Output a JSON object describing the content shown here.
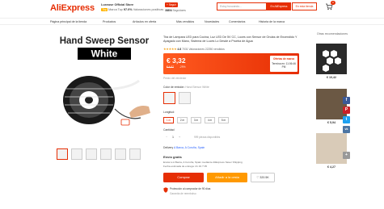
{
  "header": {
    "logo": "AliExpress",
    "store_name": "Luxeuse Official Store",
    "store_tag": "Top",
    "store_badge": "Marca Top",
    "rating_pct": "97.0%",
    "rating_text": "Valoraciones positivas",
    "follow_label": "+ Seguir",
    "followers_count": "38854",
    "followers_label": "Seguidores",
    "search_placeholder": "Estoy buscando...",
    "search_btn": "En AliExpress",
    "search_store_btn": "En esta tienda",
    "cart_count": "0"
  },
  "store_nav": [
    "Página principal de la tienda",
    "Productos",
    "Artículos en oferta",
    "Más vendidos",
    "Novedades",
    "Comentarios",
    "Historia de la marca"
  ],
  "product": {
    "title": "Tira de Lámpara LED para Cocina, Luz LED De 5V CC, Luces con Sensor de Ondas de Encendido Y Apagado con Mano, Sistema de Luces Lo Desde a Prueba de Agua",
    "stars": "★★★★★",
    "rating_value": "4.8",
    "reviews": "7031 Valoraciones",
    "sold": "22250 vendidos",
    "image_caption_1": "Hand Sweep Sensor",
    "image_caption_2": "White"
  },
  "price": {
    "current": "€ 3,32",
    "original": "€ 4,67",
    "discount": "-29%",
    "promo_title": "Ofertas de marca",
    "promo_time": "Termina en: 11:06:46 PM"
  },
  "after_price": "Precio del vendedor",
  "options": {
    "color_label": "Color de emisión:",
    "color_value": "Hand Sensor White",
    "length_label": "Longitud:",
    "lengths": [
      "1 m",
      "2 m",
      "3 m",
      "4 m",
      "5 m"
    ],
    "qty_label": "Cantidad",
    "qty_minus": "−",
    "qty_value": "1",
    "qty_plus": "+",
    "qty_avail": "999 piezas disponibles"
  },
  "delivery": {
    "label": "Delivery",
    "value": "A Barca, A Coruña, Spain"
  },
  "shipping": {
    "title": "Envío gratis",
    "line1": "Enviar a A Barca, A Coruña, Spain mediante AliExpress Saver Shipping",
    "line2": "Fecha estimada de entrega: 21 19 ? 05"
  },
  "actions": {
    "buy": "Comprar",
    "add_cart": "Añadir a la cesta",
    "wish_count": "320.5K"
  },
  "protection": {
    "title": "Protección al comprador de 90 días",
    "subtitle": "Garantía de reembolso"
  },
  "recommend": {
    "title": "Otras recomendaciones",
    "prices": [
      "€ 10,42",
      "€ 5,94",
      "€ 4,27"
    ]
  },
  "share_icons": [
    {
      "name": "facebook",
      "label": "f",
      "color": "#3b5998"
    },
    {
      "name": "pinterest",
      "label": "P",
      "color": "#cb2027"
    },
    {
      "name": "twitter",
      "label": "t",
      "color": "#1da1f2"
    },
    {
      "name": "vk",
      "label": "vk",
      "color": "#4c75a3"
    },
    {
      "name": "more",
      "label": "+",
      "color": "#999999"
    }
  ],
  "colors": {
    "accent": "#e62e04",
    "orange": "#ff9900",
    "star": "#f5a623"
  }
}
